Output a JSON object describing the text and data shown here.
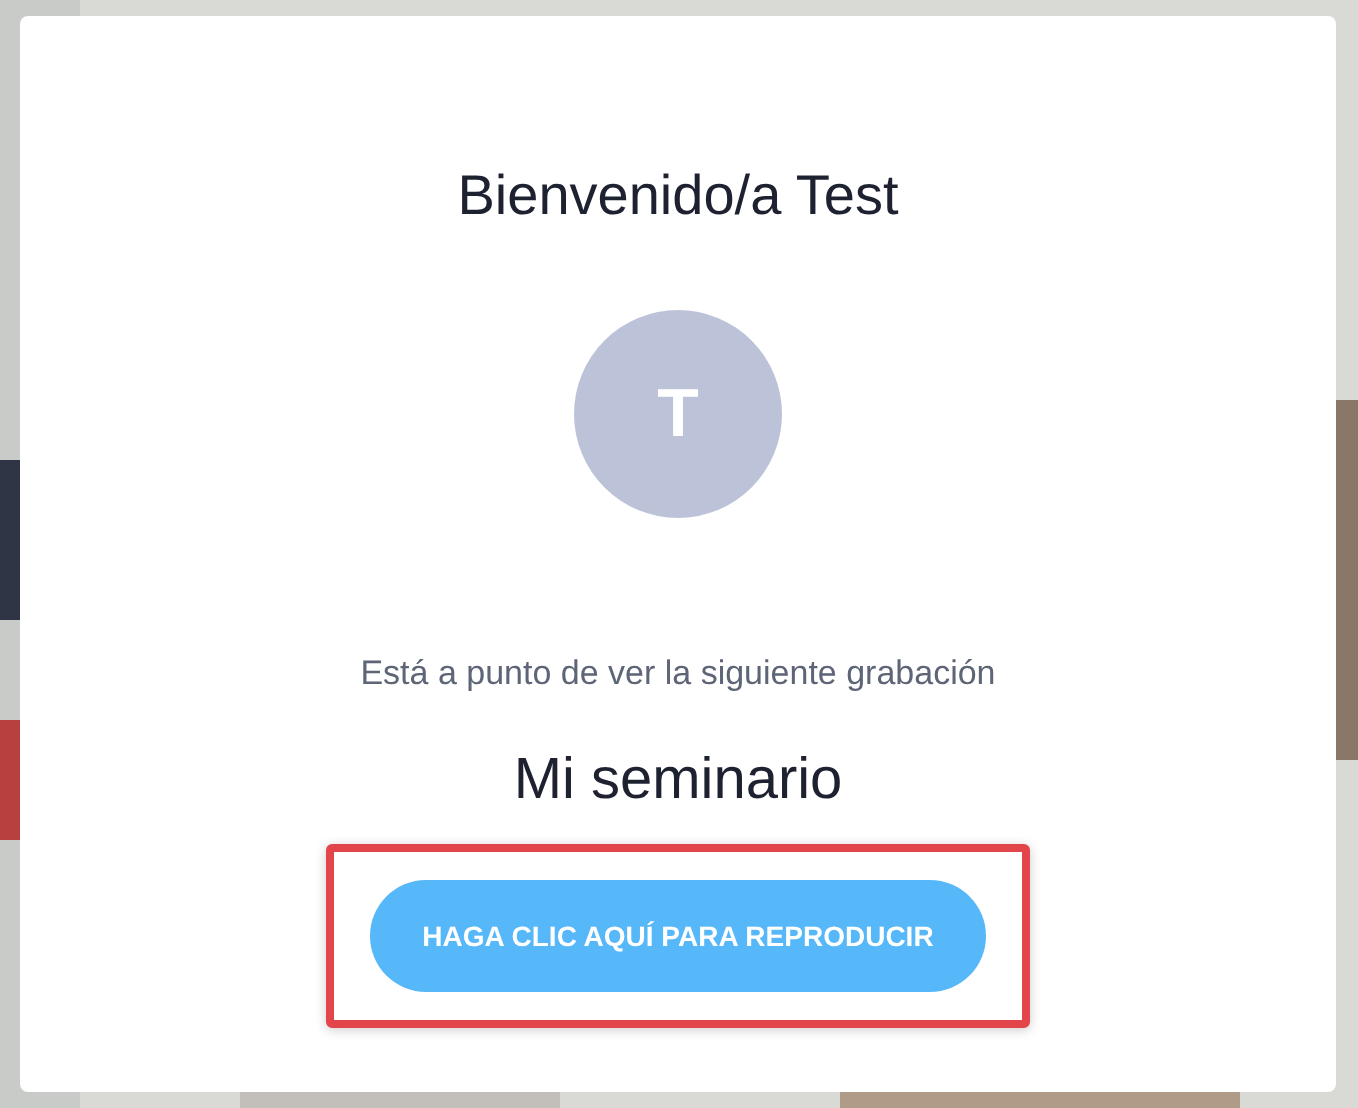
{
  "dialog": {
    "title": "Bienvenido/a Test",
    "avatar": {
      "initial": "T"
    },
    "message": "Está a punto de ver la siguiente grabación",
    "recording_title": "Mi seminario",
    "play_button": {
      "label": "HAGA CLIC AQUÍ PARA REPRODUCIR",
      "highlighted": true
    }
  }
}
